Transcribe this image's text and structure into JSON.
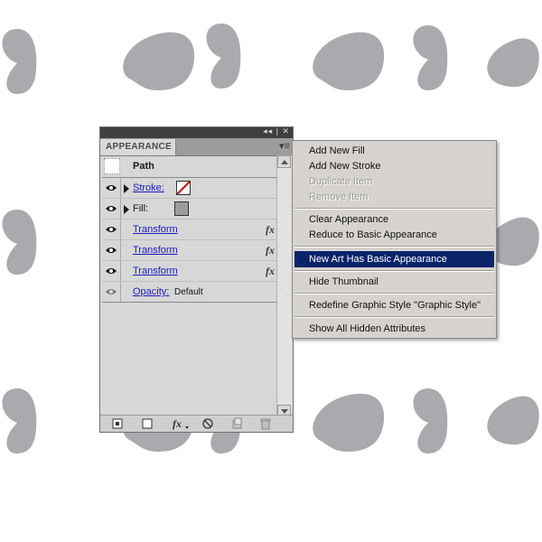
{
  "colors": {
    "blob": "#a9aaad",
    "menu_selected": "#0a246a",
    "link": "#1b1bbd"
  },
  "panel": {
    "tab_label": "APPEARANCE",
    "topbar_buttons_icon": "collapse-and-close-icons",
    "header": {
      "label": "Path"
    },
    "rows": [
      {
        "label": "Stroke:",
        "kind": "stroke"
      },
      {
        "label": "Fill:",
        "kind": "fill"
      },
      {
        "label": "Transform",
        "fx": "fx"
      },
      {
        "label": "Transform",
        "fx": "fx"
      },
      {
        "label": "Transform",
        "fx": "fx"
      },
      {
        "label": "Opacity:",
        "value": "Default"
      }
    ]
  },
  "menu": {
    "items": [
      {
        "label": "Add New Fill",
        "enabled": true
      },
      {
        "label": "Add New Stroke",
        "enabled": true
      },
      {
        "label": "Duplicate Item",
        "enabled": false
      },
      {
        "label": "Remove Item",
        "enabled": false
      },
      {
        "label": "Clear Appearance",
        "enabled": true
      },
      {
        "label": "Reduce to Basic Appearance",
        "enabled": true
      },
      {
        "label": "New Art Has Basic Appearance",
        "enabled": true,
        "selected": true
      },
      {
        "label": "Hide Thumbnail",
        "enabled": true
      },
      {
        "label": "Redefine Graphic Style \"Graphic Style\"",
        "enabled": true
      },
      {
        "label": "Show All Hidden Attributes",
        "enabled": true
      }
    ]
  }
}
